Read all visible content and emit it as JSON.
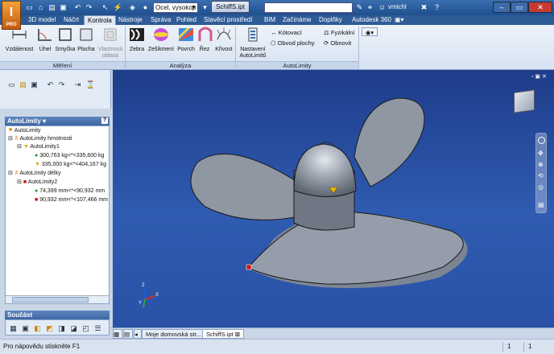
{
  "titlebar": {
    "material": "Ocel, vysokop",
    "document": "SchiffS.ipt",
    "user": "vmichl",
    "logo_text": "PRO"
  },
  "tabs": [
    {
      "label": "3D model"
    },
    {
      "label": "Náčrt"
    },
    {
      "label": "Kontrola"
    },
    {
      "label": "Nástroje"
    },
    {
      "label": "Správa"
    },
    {
      "label": "Pohled"
    },
    {
      "label": "Stavěcí prostředí"
    },
    {
      "label": "BIM"
    },
    {
      "label": "Začínáme"
    },
    {
      "label": "Doplňky"
    },
    {
      "label": "Autodesk 360"
    }
  ],
  "ribbon": {
    "mereni": {
      "label": "Měření",
      "buttons": [
        "Vzdálenost",
        "Úhel",
        "Smyčka",
        "Plocha",
        "Vlastnosti oblasti"
      ]
    },
    "analyza": {
      "label": "Analýza",
      "buttons": [
        "Zebra",
        "Zešikmení",
        "Povrch",
        "Řez",
        "Křivost"
      ]
    },
    "autolimity": {
      "label": "AutoLimity",
      "main_button": "Nastavení AutoLimitů",
      "small": [
        "Kótovací",
        "Obvod plochy",
        "Fyzikální",
        "Obnovit"
      ]
    }
  },
  "browser": {
    "title": "AutoLimity",
    "root": "AutoLimity",
    "items": [
      {
        "label": "AutoLimity hmotnosti",
        "level": 1,
        "icon": "mass-limit-icon"
      },
      {
        "label": "AutoLimity1",
        "level": 2,
        "icon": "yellow-triangle-icon"
      },
      {
        "label": "300,763 kg<*<335,600 kg",
        "level": 3,
        "icon": "green-circle-icon"
      },
      {
        "label": "335,000 kg<*<404,167 kg",
        "level": 3,
        "icon": "yellow-triangle-icon"
      },
      {
        "label": "AutoLimity délky",
        "level": 1,
        "icon": "length-limit-icon"
      },
      {
        "label": "AutoLimity2",
        "level": 2,
        "icon": "red-square-icon"
      },
      {
        "label": "74,399 mm<*<90,932 mm",
        "level": 3,
        "icon": "green-circle-icon"
      },
      {
        "label": "90,932 mm<*<107,466 mm",
        "level": 3,
        "icon": "red-square-icon"
      }
    ]
  },
  "part_panel": {
    "title": "Součást"
  },
  "doc_tabs": [
    {
      "label": "Moje domovská str..."
    },
    {
      "label": "SchiffS.ipt"
    }
  ],
  "status": {
    "help": "Pro nápovědu stiskněte F1",
    "count1": "1",
    "count2": "1"
  },
  "colors": {
    "viewport_top": "#1e3c8a",
    "viewport_bottom": "#2952a6",
    "model": "#8f97a3"
  }
}
